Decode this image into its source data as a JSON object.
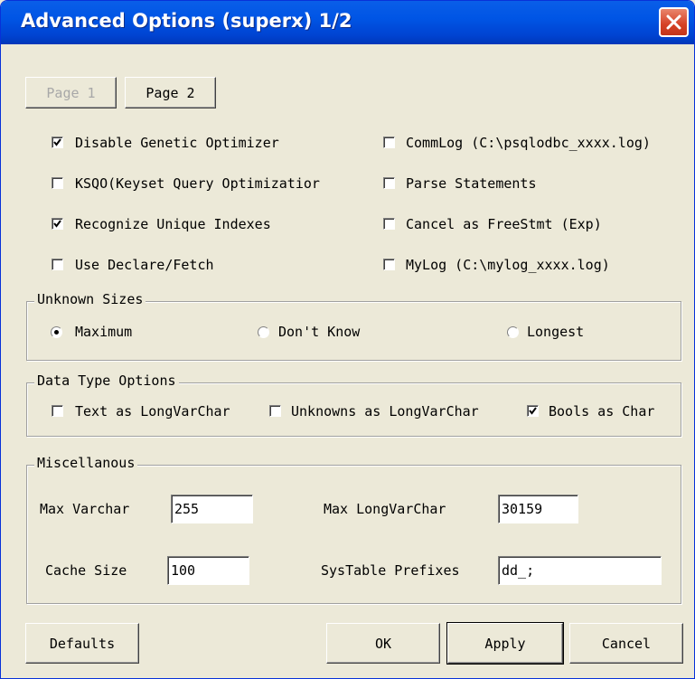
{
  "window": {
    "title": "Advanced Options (superx) 1/2"
  },
  "tabs": {
    "page1": "Page 1",
    "page2": "Page 2"
  },
  "options": {
    "disable_genetic": {
      "label": "Disable Genetic Optimizer",
      "checked": true
    },
    "ksqo": {
      "label": "KSQO(Keyset Query Optimizatior",
      "checked": false
    },
    "recognize_unique": {
      "label": "Recognize Unique Indexes",
      "checked": true
    },
    "use_declare": {
      "label": "Use Declare/Fetch",
      "checked": false
    },
    "commlog": {
      "label": "CommLog (C:\\psqlodbc_xxxx.log)",
      "checked": false
    },
    "parse_statements": {
      "label": "Parse Statements",
      "checked": false
    },
    "cancel_freestmt": {
      "label": "Cancel as FreeStmt (Exp)",
      "checked": false
    },
    "mylog": {
      "label": "MyLog (C:\\mylog_xxxx.log)",
      "checked": false
    }
  },
  "unknown_sizes": {
    "legend": "Unknown Sizes",
    "maximum": {
      "label": "Maximum",
      "selected": true
    },
    "dont_know": {
      "label": "Don't Know",
      "selected": false
    },
    "longest": {
      "label": "Longest",
      "selected": false
    }
  },
  "data_type_options": {
    "legend": "Data Type Options",
    "text_as_longvarchar": {
      "label": "Text as LongVarChar",
      "checked": false
    },
    "unknowns_as_longvarchar": {
      "label": "Unknowns as LongVarChar",
      "checked": false
    },
    "bools_as_char": {
      "label": "Bools as Char",
      "checked": true
    }
  },
  "misc": {
    "legend": "Miscellanous",
    "max_varchar": {
      "label": "Max Varchar",
      "value": "255"
    },
    "max_longvarchar": {
      "label": "Max LongVarChar",
      "value": "30159"
    },
    "cache_size": {
      "label": "Cache Size",
      "value": "100"
    },
    "systable_prefixes": {
      "label": "SysTable Prefixes",
      "value": "dd_;"
    }
  },
  "buttons": {
    "defaults": "Defaults",
    "ok": "OK",
    "apply": "Apply",
    "cancel": "Cancel"
  },
  "icons": {
    "close": "close-icon",
    "check": "check-icon"
  }
}
